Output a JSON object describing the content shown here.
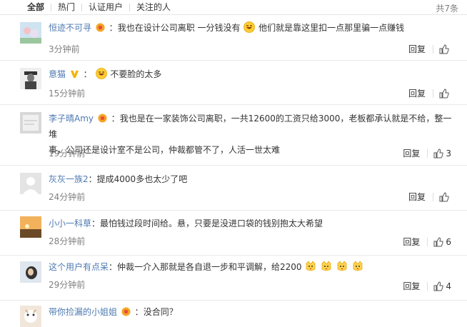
{
  "tabs": [
    "全部",
    "热门",
    "认证用户",
    "关注的人"
  ],
  "total_count": "共7条",
  "reply_label": "回复",
  "comments": [
    {
      "user": "恒迹不可寻",
      "colon": "：",
      "text_a": "我也在设计公司离职 一分钱没有",
      "text_b": "他们就是靠这里扣一点那里骗一点赚钱",
      "time": "3分钟前",
      "likes": ""
    },
    {
      "user": "意猫",
      "colon": "：",
      "text_a": "不要脸的太多",
      "time": "15分钟前",
      "likes": ""
    },
    {
      "user": "李子晴Amy",
      "colon": "：",
      "text_a": "我也是在一家装饰公司离职，一共12600的工资只给3000，老板都承认就是不给，整一堆",
      "text_b": "事，公司还是设计室不是公司，仲裁都管不了，人活一世太难",
      "time": "19分钟前",
      "likes": "3"
    },
    {
      "user": "灰灰一族2",
      "colon": "：",
      "text_a": "提成4000多也太少了吧",
      "time": "24分钟前",
      "likes": ""
    },
    {
      "user": "小小一科草",
      "colon": "：",
      "text_a": "最怕钱过段时间给。悬，只要是没进口袋的钱别抱太大希望",
      "time": "28分钟前",
      "likes": "6"
    },
    {
      "user": "这个用户有点呆",
      "colon": "：",
      "text_a": "仲裁一介入那就是各自退一步和平调解，给2200",
      "time": "29分钟前",
      "likes": "4"
    },
    {
      "user": "带你捡漏的小姐姐",
      "colon": "：",
      "text_a": "没合同？",
      "time": "",
      "likes": ""
    }
  ]
}
